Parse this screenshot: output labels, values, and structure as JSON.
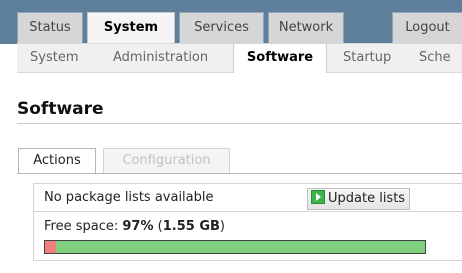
{
  "nav": {
    "tabs": [
      "Status",
      "System",
      "Services",
      "Network",
      "Logout"
    ],
    "active_tab": "System"
  },
  "subnav": {
    "items": [
      "System",
      "Administration",
      "Software",
      "Startup",
      "Sche"
    ],
    "active_item": "Software"
  },
  "page": {
    "title": "Software"
  },
  "content_tabs": {
    "items": [
      "Actions",
      "Configuration"
    ],
    "active": "Actions"
  },
  "actions": {
    "package_status": "No package lists available",
    "update_button_label": "Update lists",
    "free_space_prefix": "Free space: ",
    "free_space_percent": "97%",
    "free_space_paren_open": " (",
    "free_space_size": "1.55 GB",
    "free_space_paren_close": ")",
    "free_space_fraction": 0.97
  },
  "colors": {
    "nav_background": "#5e7f9c",
    "free_bar": "#7fcf7f",
    "used_bar": "#f07f7f",
    "update_icon": "#3bb54a"
  },
  "icons": {
    "update_button": "play-refresh-icon"
  }
}
